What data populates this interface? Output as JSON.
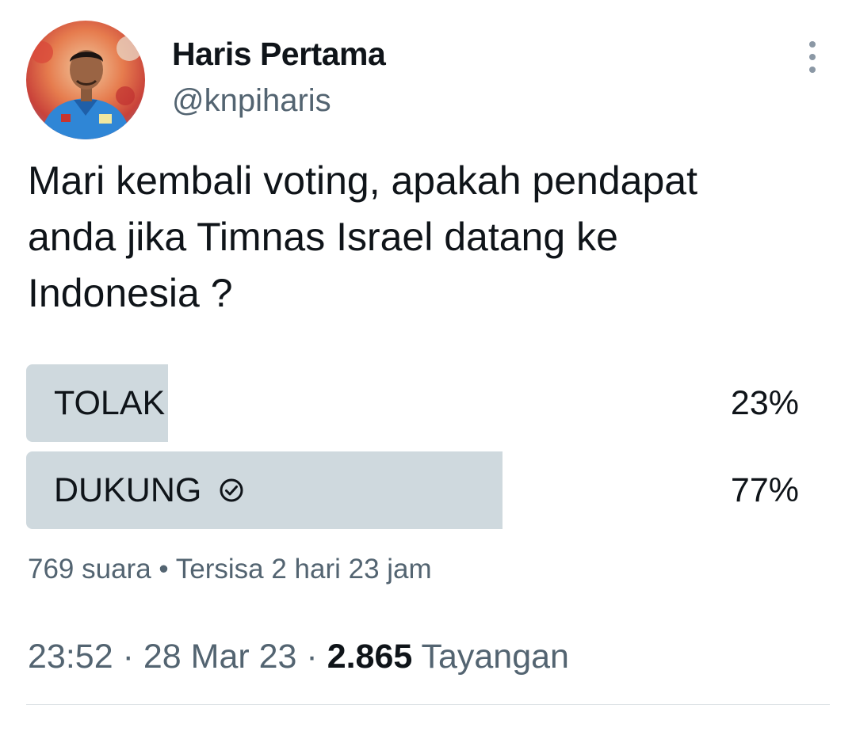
{
  "author": {
    "display_name": "Haris Pertama",
    "handle": "@knpiharis"
  },
  "tweet": {
    "text": "Mari kembali voting, apakah pendapat\nanda jika Timnas Israel datang ke\nIndonesia ?"
  },
  "poll": {
    "options": [
      {
        "label": "TOLAK",
        "percent": "23%",
        "share": 0.23,
        "selected": false
      },
      {
        "label": "DUKUNG",
        "percent": "77%",
        "share": 0.77,
        "selected": true
      }
    ],
    "votes": "769 suara",
    "separator": "•",
    "remaining": "Tersisa 2 hari 23 jam"
  },
  "meta": {
    "time": "23:52",
    "dot": "·",
    "date": "28 Mar 23",
    "views_count": "2.865",
    "views_label": "Tayangan"
  },
  "colors": {
    "poll_fill": "#cfd9de",
    "secondary_text": "#536471",
    "primary_text": "#0f1419"
  },
  "icons": {
    "more": "more-vertical-icon",
    "selected": "check-circle-icon"
  }
}
